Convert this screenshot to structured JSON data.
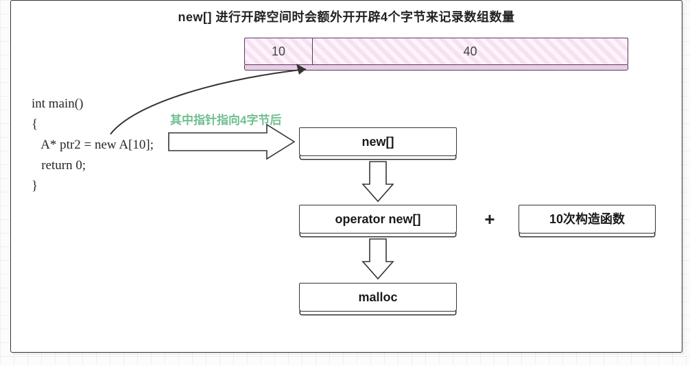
{
  "title_prefix": "new[]",
  "title_text": "进行开辟空间时会额外开开辟4个字节来记录数组数量",
  "memory": {
    "count_cell": "10",
    "data_cell": "40"
  },
  "code": {
    "line1": "int main()",
    "line2": "{",
    "line3": "   A* ptr2 = new A[10];",
    "line4": "   return 0;",
    "line5": "}"
  },
  "annotation_green": "其中指针指向4字节后",
  "flow": {
    "box_new": "new[]",
    "box_opnew": "operator new[]",
    "plus": "+",
    "box_ctor": "10次构造函数",
    "box_malloc": "malloc"
  }
}
